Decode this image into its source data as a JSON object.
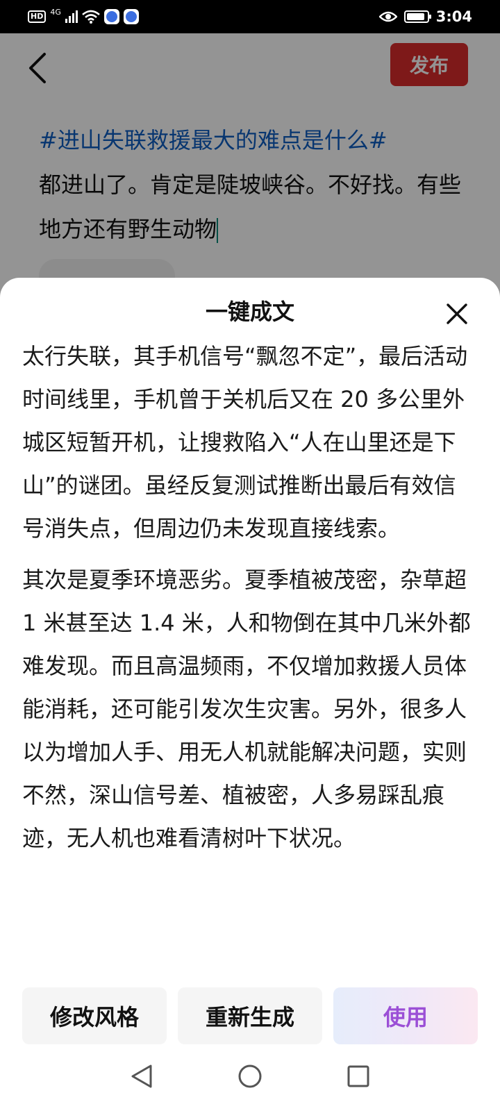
{
  "status_bar": {
    "hd_label": "HD",
    "network_label": "4G",
    "time": "3:04",
    "battery_level": 0.9
  },
  "editor": {
    "publish_label": "发布",
    "hashtag": "#进山失联救援最大的难点是什么#",
    "body_text": "都进山了。肯定是陡坡峡谷。不好找。有些地方还有野生动物"
  },
  "sheet": {
    "title": "一键成文",
    "paragraphs": [
      "太行失联，其手机信号“飘忽不定”，最后活动时间线里，手机曾于关机后又在 20 多公里外城区短暂开机，让搜救陷入“人在山里还是下山”的谜团。虽经反复测试推断出最后有效信号消失点，但周边仍未发现直接线索。",
      "其次是夏季环境恶劣。夏季植被茂密，杂草超 1 米甚至达 1.4 米，人和物倒在其中几米外都难发现。而且高温频雨，不仅增加救援人员体能消耗，还可能引发次生灾害。另外，很多人以为增加人手、用无人机就能解决问题，实则不然，深山信号差、植被密，人多易踩乱痕迹，无人机也难看清树叶下状况。"
    ],
    "actions": {
      "modify_style": "修改风格",
      "regenerate": "重新生成",
      "use": "使用"
    }
  },
  "colors": {
    "publish_red": "#d92b2b",
    "hashtag_blue": "#0f5ec2",
    "use_text_purple": "#9b4fd6"
  }
}
